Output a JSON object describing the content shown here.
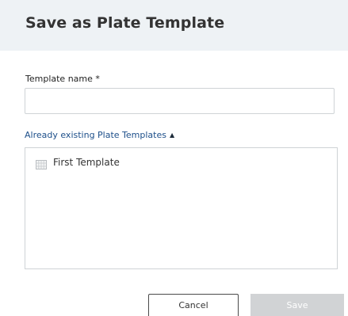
{
  "dialog": {
    "title": "Save as Plate Template"
  },
  "template_name": {
    "label": "Template name *",
    "value": "",
    "placeholder": ""
  },
  "existing_templates": {
    "toggle_label": "Already existing Plate Templates",
    "expanded": true,
    "items": [
      {
        "label": "First Template",
        "icon": "plate-grid-icon"
      }
    ]
  },
  "actions": {
    "cancel_label": "Cancel",
    "save_label": "Save",
    "save_disabled": true
  },
  "colors": {
    "header_background": "#eef2f5",
    "link": "#1d4f8a",
    "disabled_button": "#d1d3d5"
  }
}
